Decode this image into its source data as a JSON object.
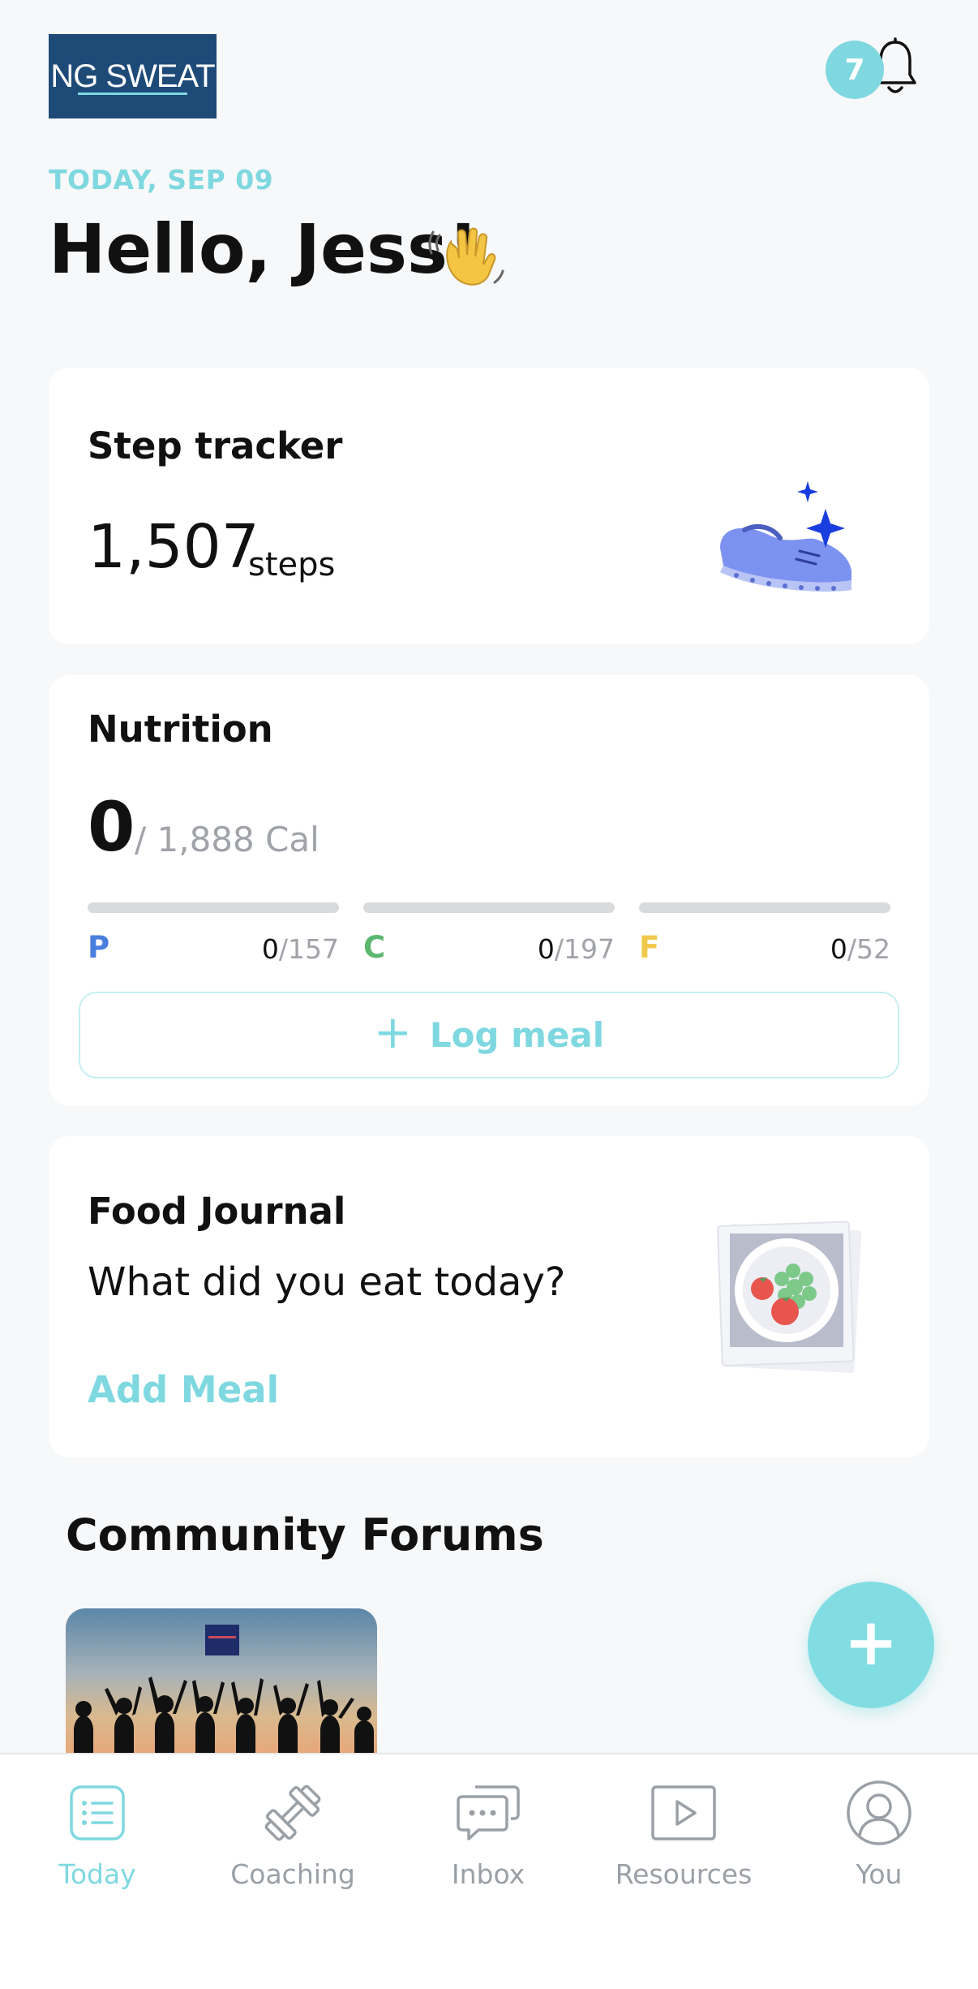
{
  "header": {
    "logo_text": "NG SWEAT",
    "notification_count": "7",
    "date": "TODAY, SEP 09",
    "greeting": "Hello, Jess!"
  },
  "step_tracker": {
    "title": "Step tracker",
    "count": "1,507",
    "unit": "steps"
  },
  "nutrition": {
    "title": "Nutrition",
    "calories": "0",
    "calorie_goal": "/ 1,888 Cal",
    "macros": [
      {
        "letter": "P",
        "current": "0",
        "goal": "/157",
        "color": "#4a7fe0",
        "progress": 0
      },
      {
        "letter": "C",
        "current": "0",
        "goal": "/197",
        "color": "#5cb870",
        "progress": 0
      },
      {
        "letter": "F",
        "current": "0",
        "goal": "/52",
        "color": "#f0c94a",
        "progress": 0
      }
    ],
    "log_meal_label": "Log meal"
  },
  "food_journal": {
    "title": "Food Journal",
    "question": "What did you eat today?",
    "add_meal_label": "Add Meal"
  },
  "community": {
    "title": "Community Forums"
  },
  "tabs": [
    {
      "label": "Today",
      "icon": "list-icon",
      "active": true
    },
    {
      "label": "Coaching",
      "icon": "dumbbell-icon",
      "active": false
    },
    {
      "label": "Inbox",
      "icon": "chat-icon",
      "active": false
    },
    {
      "label": "Resources",
      "icon": "play-icon",
      "active": false
    },
    {
      "label": "You",
      "icon": "user-icon",
      "active": false
    }
  ],
  "colors": {
    "accent": "#7fd8e0",
    "brand": "#1e4a78"
  }
}
